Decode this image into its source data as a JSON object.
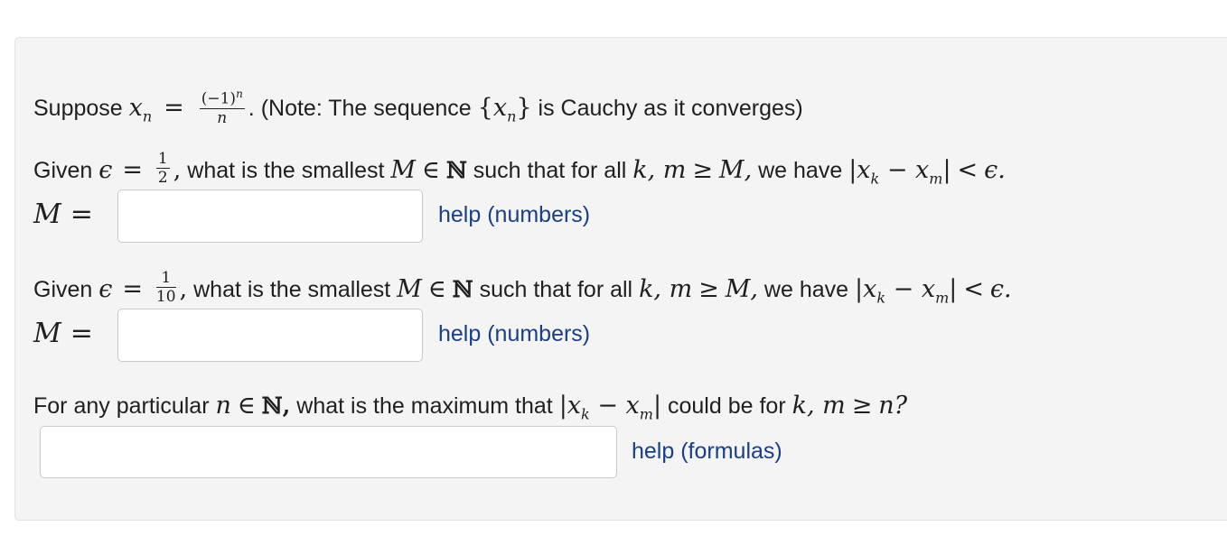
{
  "intro": {
    "prefix": "Suppose",
    "var": "x",
    "sub": "n",
    "eq": "=",
    "frac_num": "(−1)",
    "frac_num_sup": "n",
    "frac_den": "n",
    "note_a": ". (Note: The sequence",
    "set_open": "{",
    "set_close": "}",
    "note_b": "is Cauchy as it converges)"
  },
  "q1": {
    "given": "Given",
    "eps": "ϵ",
    "eq": "=",
    "frac_num": "1",
    "frac_den": "2",
    "comma": ",",
    "text_a": "what is the smallest",
    "M": "M",
    "in": "∈",
    "N": "ℕ",
    "text_b": "such that for all",
    "km": "k, m",
    "ge": "≥",
    "M2": "M,",
    "text_c": "we have",
    "abs": "|x",
    "k": "k",
    "minus": "−",
    "x": "x",
    "m": "m",
    "abs_close": "|",
    "lt": "<",
    "eps_end": "ϵ."
  },
  "q1_answer": {
    "label": "M",
    "eq": "=",
    "value": "",
    "help": "help (numbers)"
  },
  "q2": {
    "given": "Given",
    "eps": "ϵ",
    "eq": "=",
    "frac_num": "1",
    "frac_den": "10",
    "comma": ",",
    "text_a": "what is the smallest",
    "M": "M",
    "in": "∈",
    "N": "ℕ",
    "text_b": "such that for all",
    "km": "k, m",
    "ge": "≥",
    "M2": "M,",
    "text_c": "we have",
    "abs": "|x",
    "k": "k",
    "minus": "−",
    "x": "x",
    "m": "m",
    "abs_close": "|",
    "lt": "<",
    "eps_end": "ϵ."
  },
  "q2_answer": {
    "label": "M",
    "eq": "=",
    "value": "",
    "help": "help (numbers)"
  },
  "q3": {
    "text_a": "For any particular",
    "n": "n",
    "in": "∈",
    "N": "ℕ,",
    "text_b": "what is the maximum that",
    "abs": "|x",
    "k": "k",
    "minus": "−",
    "x": "x",
    "m": "m",
    "abs_close": "|",
    "text_c": "could be for",
    "km": "k, m",
    "ge": "≥",
    "n_end": "n?"
  },
  "q3_answer": {
    "value": "",
    "help": "help (formulas)"
  }
}
